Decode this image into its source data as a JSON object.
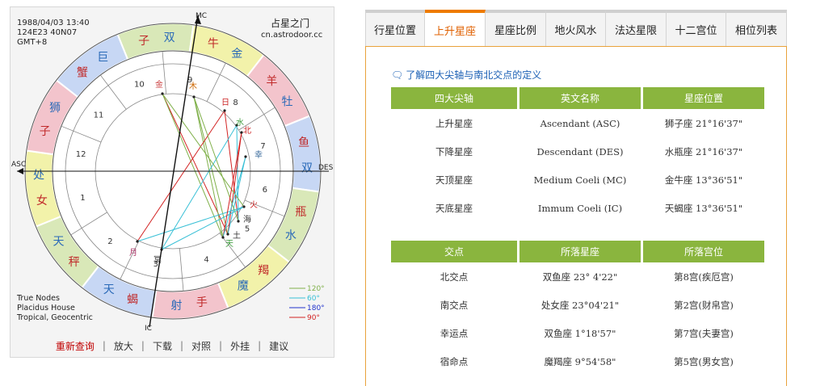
{
  "chart": {
    "info": {
      "date": "1988/04/03 13:40",
      "coords": "124E23 40N07",
      "tz": "GMT+8"
    },
    "brand": {
      "name": "占星之门",
      "url": "cn.astrodoor.cc"
    },
    "angles": {
      "mc": "MC",
      "ic": "IC",
      "asc": "ASC",
      "des": "DES"
    },
    "signs": [
      {
        "name": "双子",
        "c1": "子",
        "c2": "双",
        "color": "#d9e8b8"
      },
      {
        "name": "金牛",
        "c1": "牛",
        "c2": "金",
        "color": "#f2f2aa"
      },
      {
        "name": "白羊",
        "c1": "羊",
        "c2": "牡",
        "color": "#f3c4cc"
      },
      {
        "name": "双鱼",
        "c1": "鱼",
        "c2": "双",
        "color": "#c7d7f4"
      },
      {
        "name": "水瓶",
        "c1": "瓶",
        "c2": "水",
        "color": "#d9e8b8"
      },
      {
        "name": "摩羯",
        "c1": "羯",
        "c2": "魔",
        "color": "#f2f2aa"
      },
      {
        "name": "射手",
        "c1": "手",
        "c2": "射",
        "color": "#f3c4cc"
      },
      {
        "name": "天蝎",
        "c1": "蝎",
        "c2": "天",
        "color": "#c7d7f4"
      },
      {
        "name": "天秤",
        "c1": "秤",
        "c2": "天",
        "color": "#d9e8b8"
      },
      {
        "name": "处女",
        "c1": "女",
        "c2": "处",
        "color": "#f2f2aa"
      },
      {
        "name": "狮子",
        "c1": "子",
        "c2": "狮",
        "color": "#f3c4cc"
      },
      {
        "name": "巨蟹",
        "c1": "蟹",
        "c2": "巨",
        "color": "#c7d7f4"
      }
    ],
    "houses": [
      "1",
      "2",
      "3",
      "4",
      "5",
      "6",
      "7",
      "8",
      "9",
      "10",
      "11",
      "12"
    ],
    "planets": [
      {
        "name": "金",
        "color": "#cc4444"
      },
      {
        "name": "木",
        "color": "#cc6600"
      },
      {
        "name": "日",
        "color": "#cc2222"
      },
      {
        "name": "水",
        "color": "#3a9a3a"
      },
      {
        "name": "北",
        "color": "#cc2222"
      },
      {
        "name": "幸",
        "color": "#336699"
      },
      {
        "name": "火",
        "color": "#cc2222"
      },
      {
        "name": "海",
        "color": "#333333"
      },
      {
        "name": "土",
        "color": "#333333"
      },
      {
        "name": "天",
        "color": "#3a9a3a"
      },
      {
        "name": "月",
        "color": "#aa3366"
      },
      {
        "name": "冥",
        "color": "#333333"
      }
    ],
    "legend": {
      "notes": [
        "True Nodes",
        "Placidus House",
        "Tropical, Geocentric"
      ],
      "aspects": [
        {
          "label": "120°",
          "color": "#7fb04a"
        },
        {
          "label": "60°",
          "color": "#39c0d6"
        },
        {
          "label": "180°",
          "color": "#2233cc"
        },
        {
          "label": "90°",
          "color": "#d22222"
        }
      ]
    },
    "toolbar": [
      "重新查询",
      "放大",
      "下载",
      "对照",
      "外挂",
      "建议"
    ]
  },
  "tabs": [
    "行星位置",
    "上升星座",
    "星座比例",
    "地火风水",
    "法达星限",
    "十二宫位",
    "相位列表"
  ],
  "active_tab": "上升星座",
  "definition_link": "了解四大尖轴与南北交点的定义",
  "axis_table": {
    "headers": [
      "四大尖轴",
      "英文名称",
      "星座位置"
    ],
    "rows": [
      [
        "上升星座",
        "Ascendant (ASC)",
        "狮子座 21°16'37\""
      ],
      [
        "下降星座",
        "Descendant (DES)",
        "水瓶座 21°16'37\""
      ],
      [
        "天顶星座",
        "Medium Coeli (MC)",
        "金牛座 13°36'51\""
      ],
      [
        "天底星座",
        "Immum Coeli (IC)",
        "天蝎座 13°36'51\""
      ]
    ]
  },
  "node_table": {
    "headers": [
      "交点",
      "所落星座",
      "所落宫位"
    ],
    "rows": [
      [
        "北交点",
        "双鱼座 23° 4'22\"",
        "第8宫(疾厄宫)"
      ],
      [
        "南交点",
        "处女座 23°04'21\"",
        "第2宫(财帛宫)"
      ],
      [
        "幸运点",
        "双鱼座 1°18'57\"",
        "第7宫(夫妻宫)"
      ],
      [
        "宿命点",
        "魔羯座 9°54'58\"",
        "第5宫(男女宫)"
      ]
    ]
  }
}
